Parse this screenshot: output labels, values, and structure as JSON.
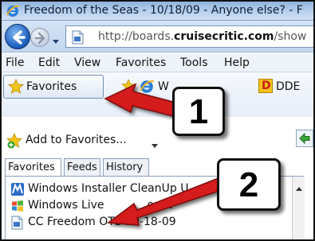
{
  "window": {
    "title": "Freedom of the Seas - 10/18/09 - Anyone else? - F"
  },
  "address": {
    "url_prefix": "http://boards.",
    "url_domain": "cruisecritic.com",
    "url_suffix": "/show"
  },
  "menu": [
    "File",
    "Edit",
    "View",
    "Favorites",
    "Tools",
    "Help"
  ],
  "favorites_bar": {
    "favorites_label": "Favorites",
    "item_w_label": "W",
    "item_dde_label": "DDE"
  },
  "favorites_panel": {
    "add_to_favorites_label": "Add to Favorites...",
    "tabs": [
      "Favorites",
      "Feeds",
      "History"
    ],
    "items": [
      "Windows Installer CleanUp U",
      "Windows Live",
      "CC Freedom OTS 10-18-09"
    ],
    "items_behind_callout": "ount"
  },
  "callouts": {
    "one": "1",
    "two": "2"
  },
  "colors": {
    "arrow_red": "#d41b1b",
    "titlebar_blue": "#b9d1ee",
    "star_gold": "#f5c518"
  },
  "icons": {
    "titlebar": "ie-logo-icon",
    "back": "back-arrow-icon",
    "forward": "forward-arrow-icon",
    "page": "page-icon",
    "favorites": "star-icon",
    "add_favorite": "add-star-icon",
    "windows_installer": "ms-logo-icon",
    "windows_live": "windows-flag-icon",
    "bookmark": "page-icon"
  }
}
